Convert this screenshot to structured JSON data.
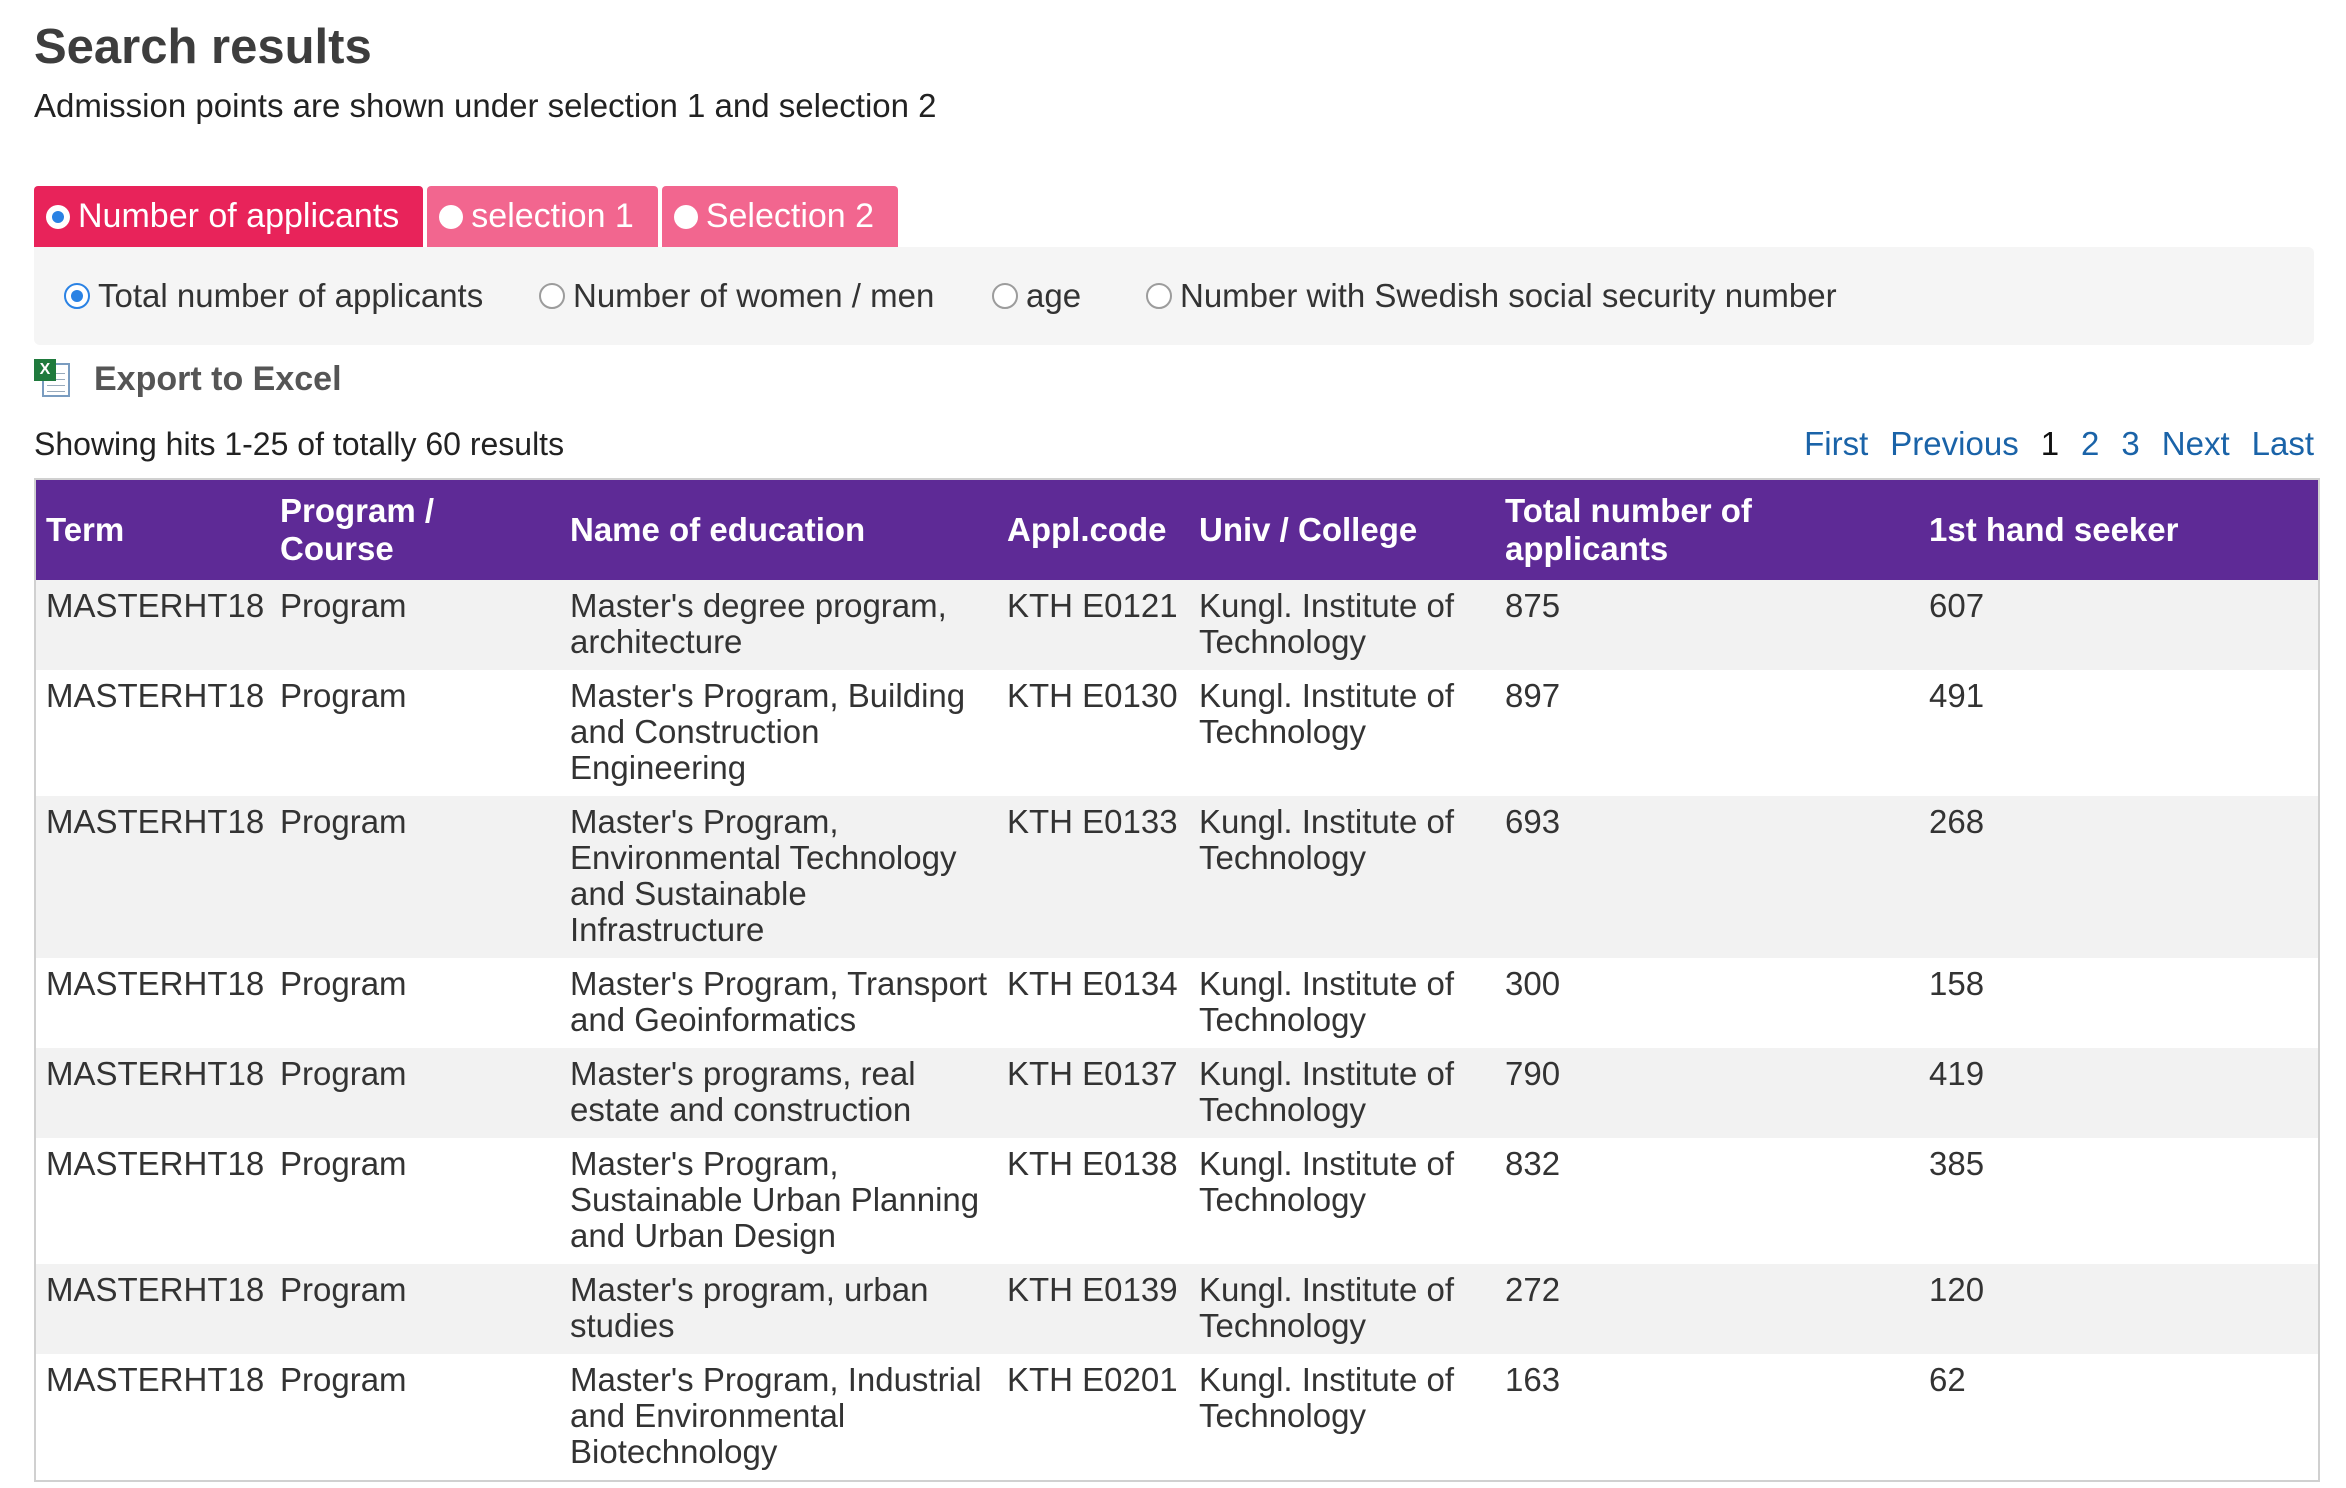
{
  "page": {
    "title": "Search results",
    "subtitle": "Admission points are shown under selection 1 and selection 2"
  },
  "tabs": [
    {
      "label": "Number of applicants",
      "active": true
    },
    {
      "label": "selection 1",
      "active": false
    },
    {
      "label": "Selection 2",
      "active": false
    }
  ],
  "filters": [
    {
      "label": "Total number of applicants",
      "checked": true
    },
    {
      "label": "Number of women / men",
      "checked": false
    },
    {
      "label": "age",
      "checked": false
    },
    {
      "label": "Number with Swedish social security number",
      "checked": false
    }
  ],
  "export": {
    "label": "Export to Excel",
    "icon": "excel-file-icon"
  },
  "results_info": "Showing hits 1-25 of totally 60 results",
  "pagination": {
    "first": "First",
    "previous": "Previous",
    "pages": [
      "1",
      "2",
      "3"
    ],
    "current": "1",
    "next": "Next",
    "last": "Last"
  },
  "table": {
    "columns": [
      "Term",
      "Program / Course",
      "Name of education",
      "Appl.code",
      "Univ / College",
      "Total number of applicants",
      "1st hand seeker"
    ],
    "rows": [
      [
        "MASTERHT18",
        "Program",
        "Master's degree program, architecture",
        "KTH E0121",
        "Kungl. Institute of Technology",
        "875",
        "607"
      ],
      [
        "MASTERHT18",
        "Program",
        "Master's Program, Building and Construction Engineering",
        "KTH E0130",
        "Kungl. Institute of Technology",
        "897",
        "491"
      ],
      [
        "MASTERHT18",
        "Program",
        "Master's Program, Environmental Technology and Sustainable Infrastructure",
        "KTH E0133",
        "Kungl. Institute of Technology",
        "693",
        "268"
      ],
      [
        "MASTERHT18",
        "Program",
        "Master's Program, Transport and Geoinformatics",
        "KTH E0134",
        "Kungl. Institute of Technology",
        "300",
        "158"
      ],
      [
        "MASTERHT18",
        "Program",
        "Master's programs, real estate and construction",
        "KTH E0137",
        "Kungl. Institute of Technology",
        "790",
        "419"
      ],
      [
        "MASTERHT18",
        "Program",
        "Master's Program, Sustainable Urban Planning and Urban Design",
        "KTH E0138",
        "Kungl. Institute of Technology",
        "832",
        "385"
      ],
      [
        "MASTERHT18",
        "Program",
        "Master's program, urban studies",
        "KTH E0139",
        "Kungl. Institute of Technology",
        "272",
        "120"
      ],
      [
        "MASTERHT18",
        "Program",
        "Master's Program, Industrial and Environmental Biotechnology",
        "KTH E0201",
        "Kungl. Institute of Technology",
        "163",
        "62"
      ]
    ]
  },
  "colors": {
    "tab_active": "#e8235a",
    "tab_inactive": "#f2668f",
    "table_header": "#5e2a96",
    "link": "#1a63a8",
    "radio_checked": "#2a82e4"
  }
}
